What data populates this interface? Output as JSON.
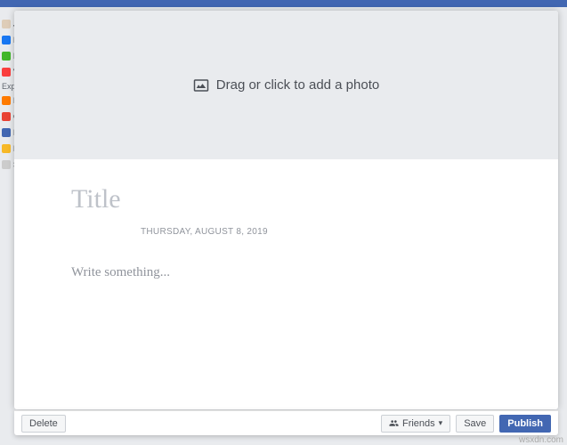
{
  "sidebar": {
    "explore_label": "Explo",
    "top": [
      {
        "letter": "J",
        "color": "#decdb8"
      },
      {
        "letter": "N",
        "color": "#1877f2"
      },
      {
        "letter": "N",
        "color": "#1877f2"
      },
      {
        "letter": "V",
        "color": "#fa3e3e"
      }
    ],
    "bottom": [
      {
        "letter": "P",
        "color": "#ff7b00"
      },
      {
        "letter": "G",
        "color": "#e94335"
      },
      {
        "letter": "E",
        "color": "#4267b2"
      },
      {
        "letter": "F",
        "color": "#f7b928"
      },
      {
        "letter": "S",
        "color": "#999"
      }
    ]
  },
  "composer": {
    "photo_drop_label": "Drag or click to add a photo",
    "title_placeholder": "Title",
    "title_value": "",
    "date_label": "THURSDAY, AUGUST 8, 2019",
    "body_placeholder": "Write something...",
    "body_value": ""
  },
  "footer": {
    "delete_label": "Delete",
    "audience_label": "Friends",
    "save_label": "Save",
    "publish_label": "Publish"
  },
  "watermark": "wsxdn.com"
}
